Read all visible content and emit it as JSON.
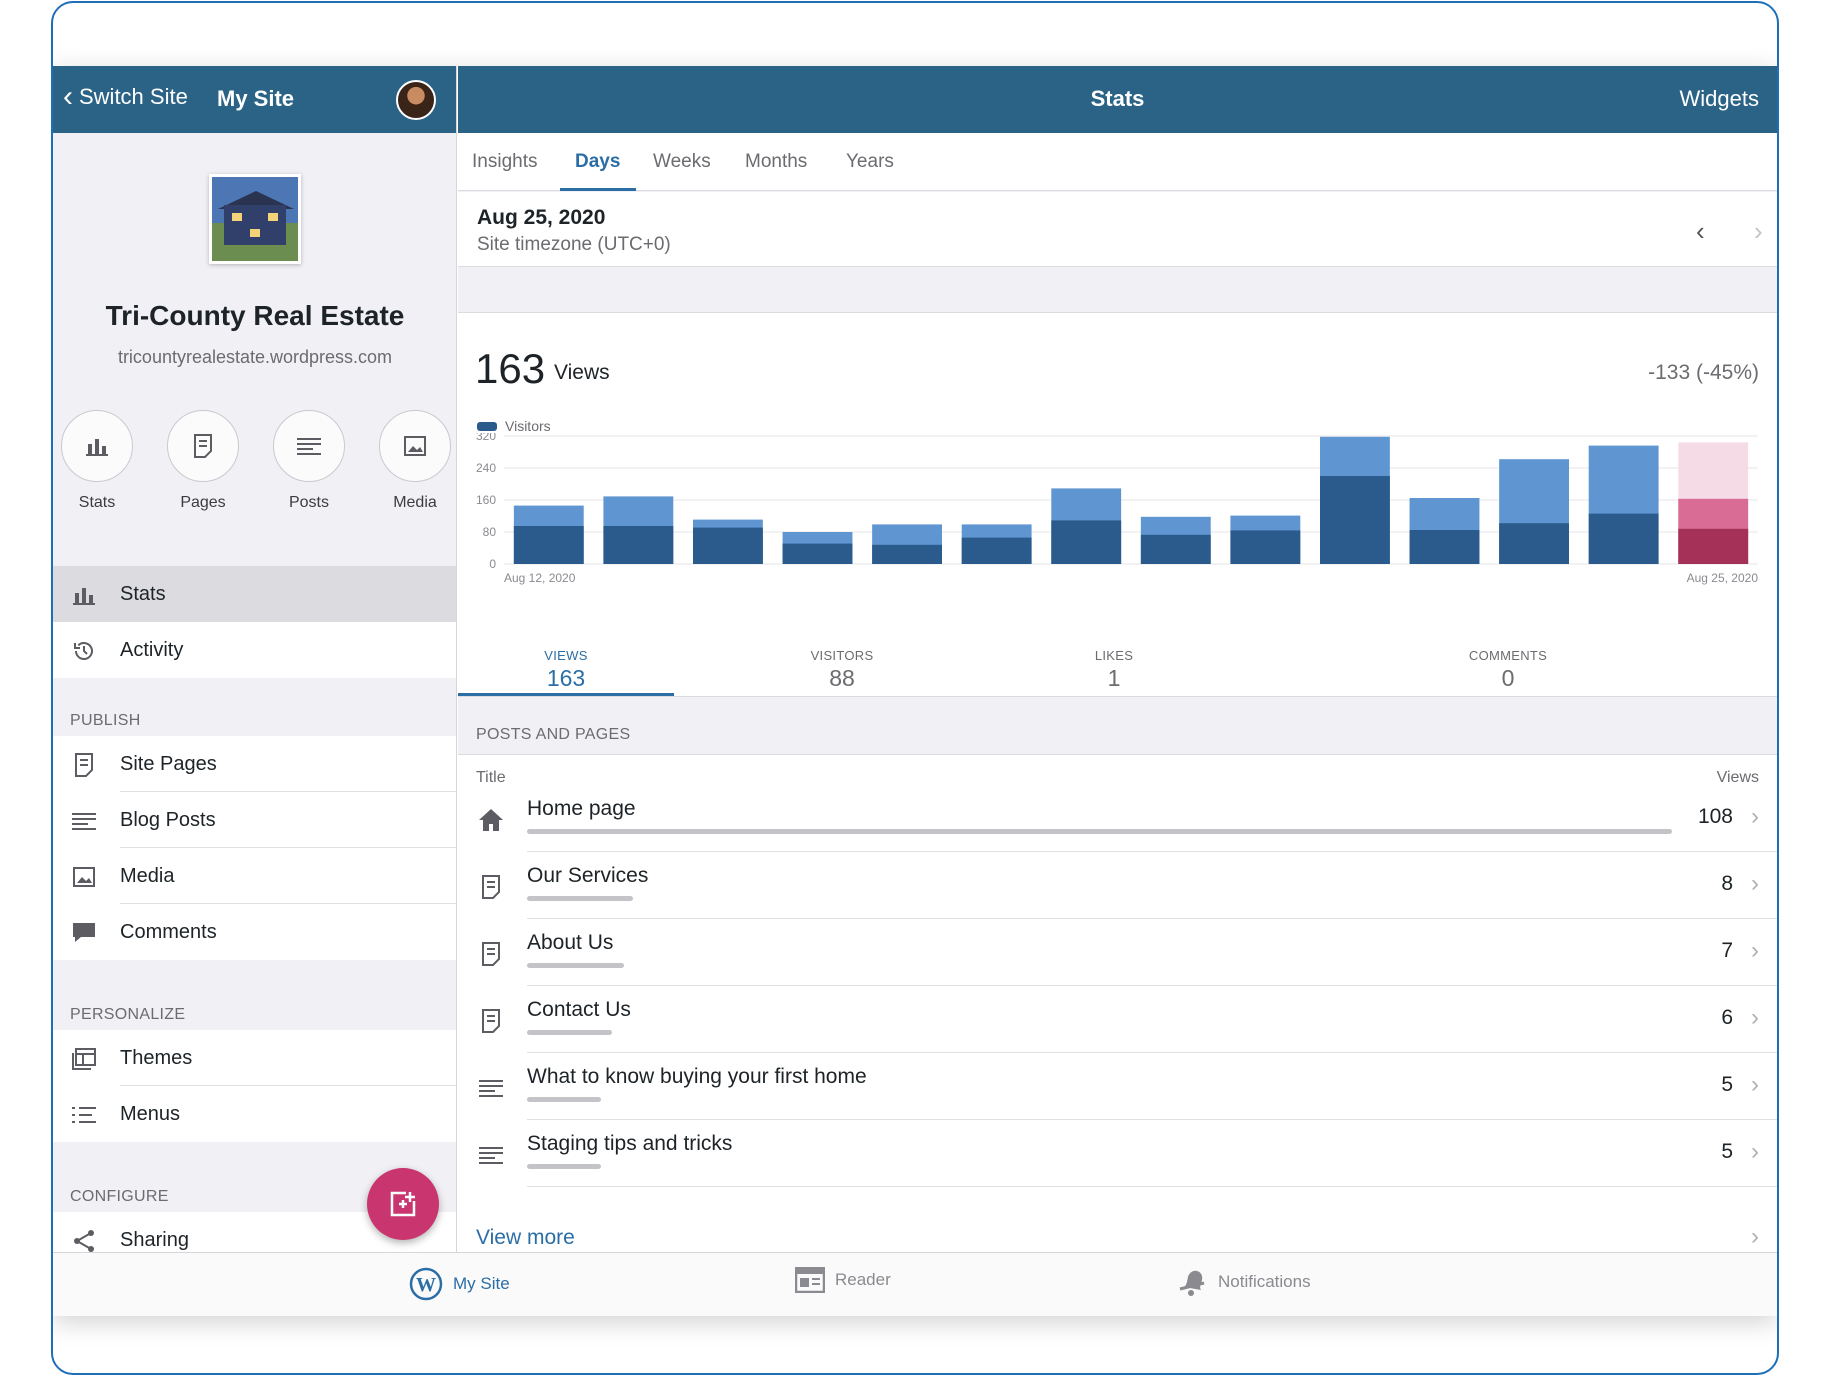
{
  "sidebar": {
    "back_label": "Switch Site",
    "site_nav_title": "My Site",
    "site_title": "Tri-County Real Estate",
    "site_url": "tricountyrealestate.wordpress.com",
    "quick_actions": [
      {
        "label": "Stats",
        "icon": "bar-chart-icon"
      },
      {
        "label": "Pages",
        "icon": "page-icon"
      },
      {
        "label": "Posts",
        "icon": "posts-icon"
      },
      {
        "label": "Media",
        "icon": "image-icon"
      }
    ],
    "items_top": [
      {
        "label": "Stats",
        "icon": "bar-chart-icon",
        "active": true
      },
      {
        "label": "Activity",
        "icon": "history-icon"
      }
    ],
    "publish_header": "PUBLISH",
    "publish_items": [
      {
        "label": "Site Pages",
        "icon": "page-icon"
      },
      {
        "label": "Blog Posts",
        "icon": "posts-icon"
      },
      {
        "label": "Media",
        "icon": "image-icon"
      },
      {
        "label": "Comments",
        "icon": "comment-icon"
      }
    ],
    "personalize_header": "PERSONALIZE",
    "personalize_items": [
      {
        "label": "Themes",
        "icon": "themes-icon"
      },
      {
        "label": "Menus",
        "icon": "menus-icon"
      }
    ],
    "configure_header": "CONFIGURE",
    "configure_items": [
      {
        "label": "Sharing",
        "icon": "share-icon"
      }
    ]
  },
  "main": {
    "title": "Stats",
    "widgets_label": "Widgets",
    "tabs": [
      "Insights",
      "Days",
      "Weeks",
      "Months",
      "Years"
    ],
    "active_tab": "Days",
    "date": "Aug 25, 2020",
    "timezone": "Site timezone (UTC+0)",
    "views_count": "163",
    "views_label": "Views",
    "delta": "-133 (-45%)",
    "summary": [
      {
        "label": "VIEWS",
        "value": "163"
      },
      {
        "label": "VISITORS",
        "value": "88"
      },
      {
        "label": "LIKES",
        "value": "1"
      },
      {
        "label": "COMMENTS",
        "value": "0"
      }
    ],
    "posts_header": "POSTS AND PAGES",
    "col_title": "Title",
    "col_views": "Views",
    "rows": [
      {
        "title": "Home page",
        "views": "108",
        "icon": "home-icon",
        "bar": 1.0
      },
      {
        "title": "Our Services",
        "views": "8",
        "icon": "page-icon",
        "bar": 0.093
      },
      {
        "title": "About Us",
        "views": "7",
        "icon": "page-icon",
        "bar": 0.085
      },
      {
        "title": "Contact Us",
        "views": "6",
        "icon": "page-icon",
        "bar": 0.074
      },
      {
        "title": "What to know buying your first home",
        "views": "5",
        "icon": "posts-icon",
        "bar": 0.065
      },
      {
        "title": "Staging tips and tricks",
        "views": "5",
        "icon": "posts-icon",
        "bar": 0.065
      }
    ],
    "view_more": "View more"
  },
  "chart_data": {
    "type": "bar",
    "legend": [
      "Visitors"
    ],
    "x_start_label": "Aug 12, 2020",
    "x_end_label": "Aug 25, 2020",
    "yticks": [
      0,
      80,
      160,
      240,
      320
    ],
    "ylim": [
      0,
      320
    ],
    "series": [
      {
        "name": "Views",
        "values": [
          146,
          169,
          111,
          80,
          99,
          99,
          189,
          118,
          121,
          318,
          165,
          262,
          296,
          163
        ]
      },
      {
        "name": "Visitors",
        "values": [
          95,
          95,
          91,
          51,
          48,
          66,
          109,
          73,
          84,
          220,
          85,
          102,
          126,
          88
        ]
      }
    ],
    "colors": {
      "views": "#5f96d2",
      "visitors": "#2b5a8c",
      "current_views": "#d86c94",
      "current_visitors": "#a53158",
      "previous_ghost": "#f5dbe6"
    }
  },
  "tabbar": [
    {
      "label": "My Site",
      "icon": "wordpress-icon",
      "active": true
    },
    {
      "label": "Reader",
      "icon": "reader-icon"
    },
    {
      "label": "Notifications",
      "icon": "bell-icon"
    }
  ]
}
